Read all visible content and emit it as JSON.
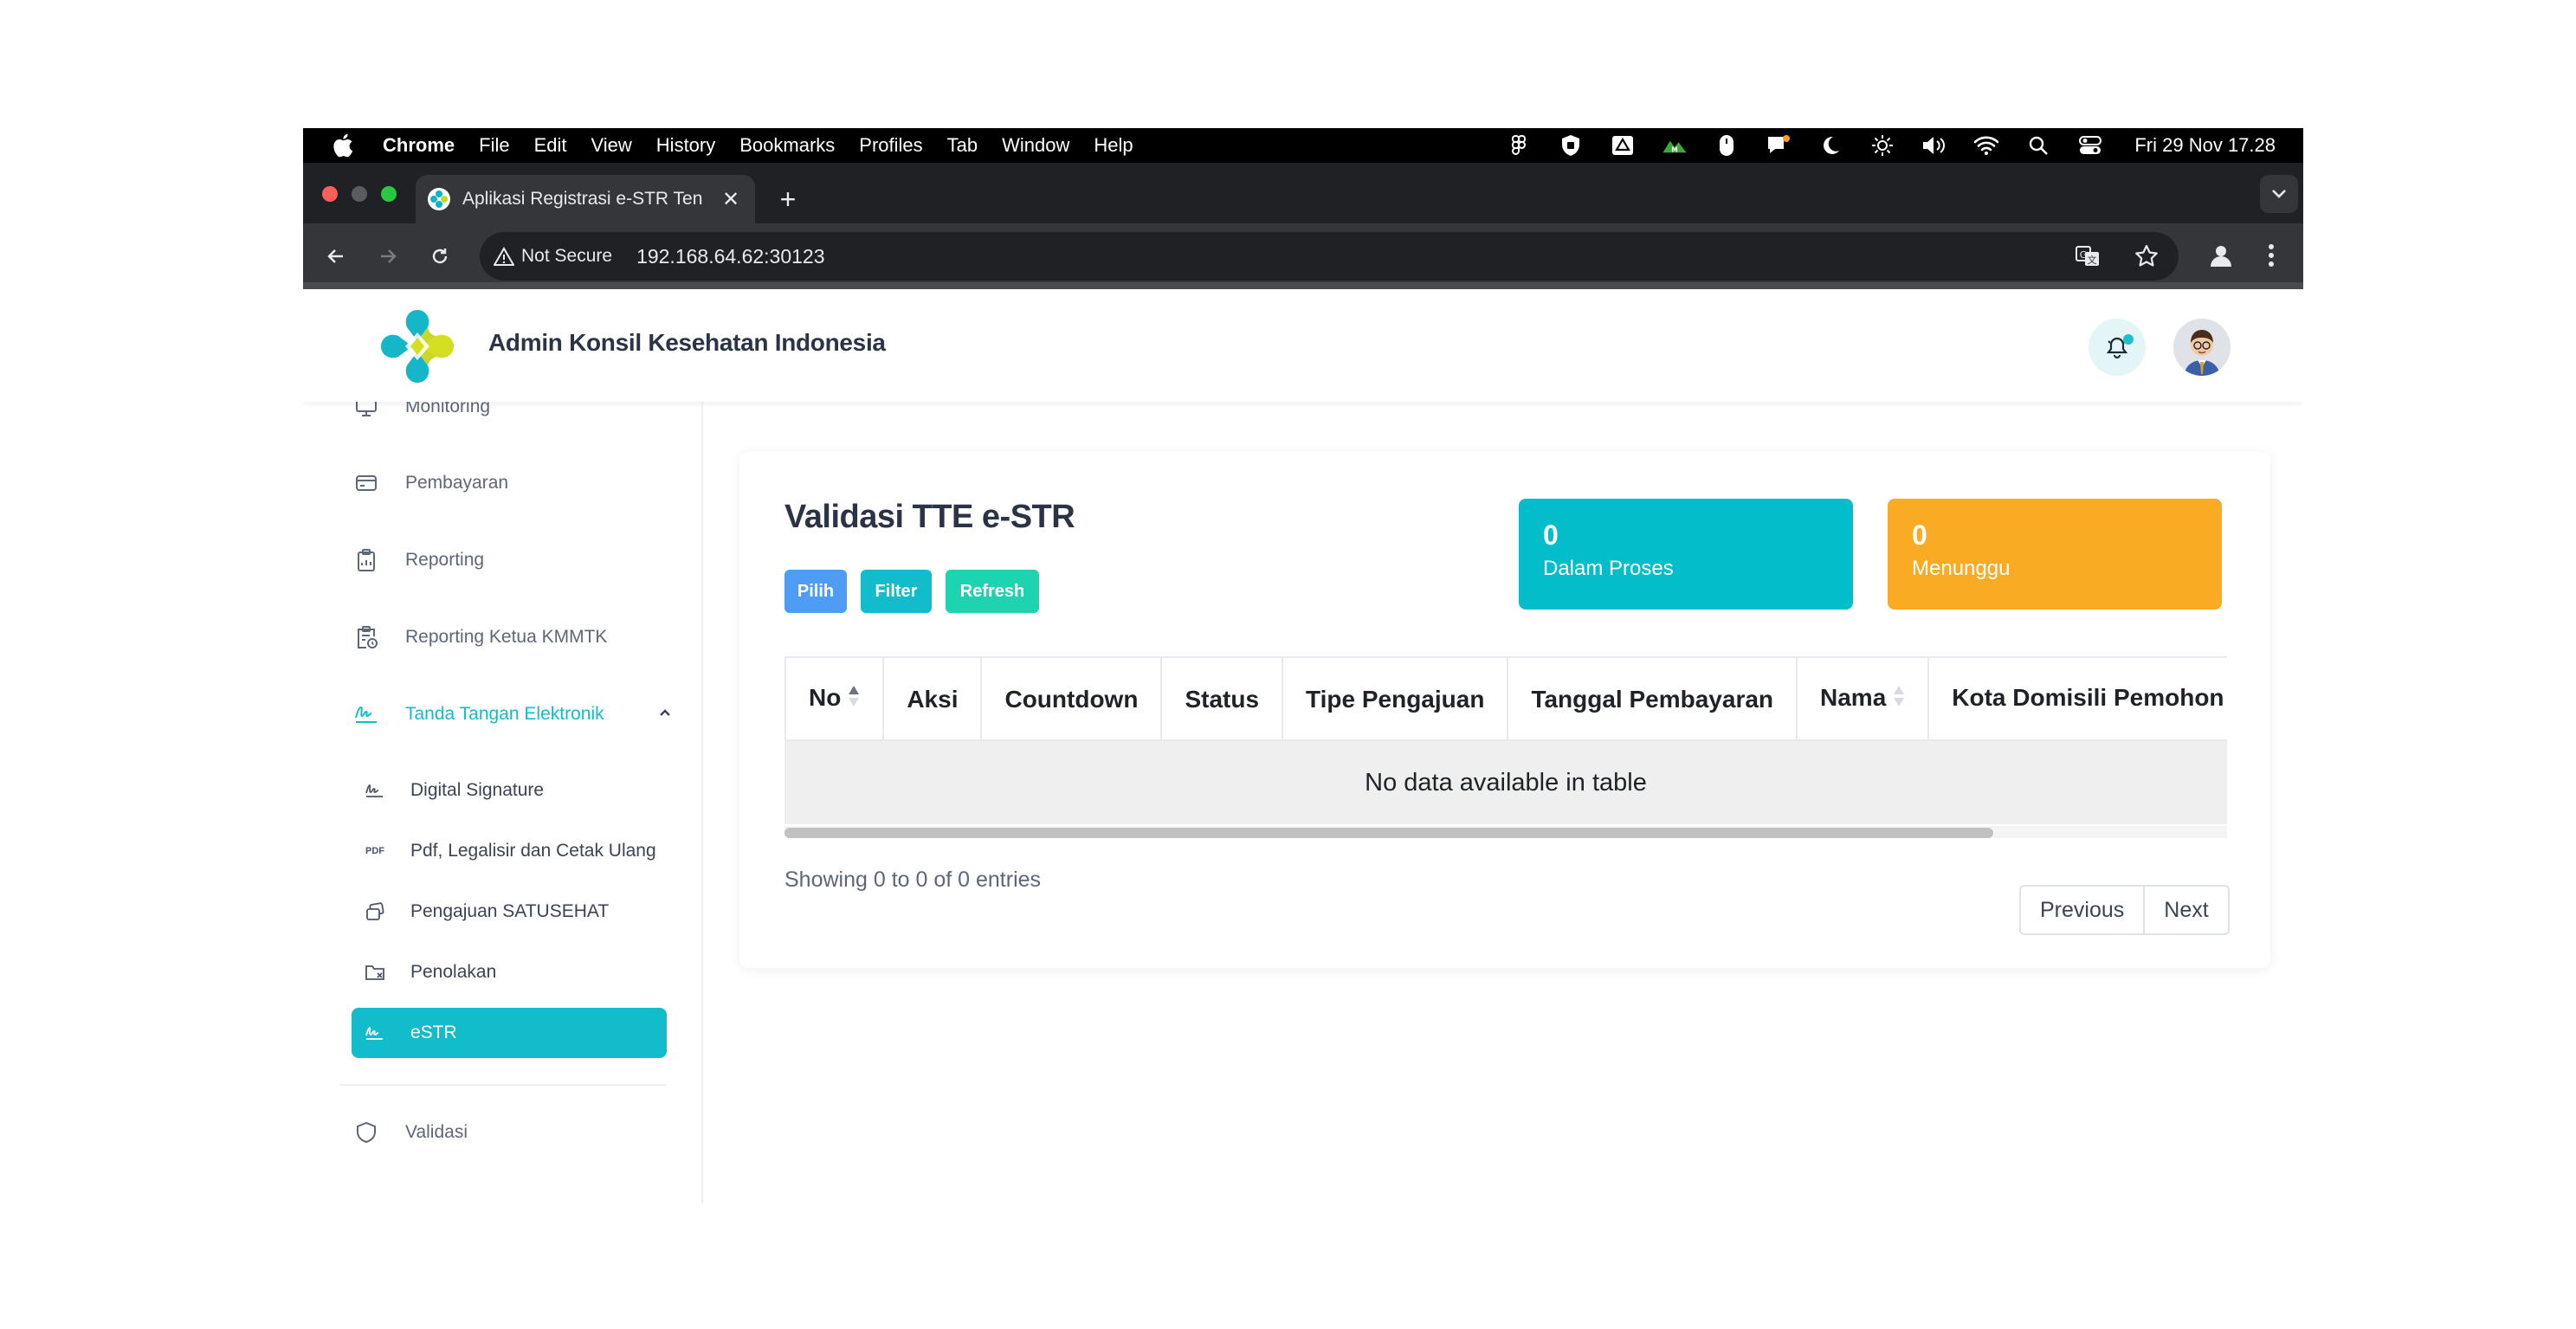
{
  "menubar": {
    "app": "Chrome",
    "items": [
      "File",
      "Edit",
      "View",
      "History",
      "Bookmarks",
      "Profiles",
      "Tab",
      "Window",
      "Help"
    ],
    "clock": "Fri 29 Nov  17.28"
  },
  "browser": {
    "tab_title": "Aplikasi Registrasi e-STR Ten",
    "not_secure": "Not Secure",
    "url": "192.168.64.62:30123"
  },
  "header": {
    "title": "Admin Konsil Kesehatan Indonesia"
  },
  "sidebar": {
    "top_partial": "Monitoring",
    "items": [
      {
        "label": "Pembayaran",
        "icon": "card-icon"
      },
      {
        "label": "Reporting",
        "icon": "clipboard-icon"
      },
      {
        "label": "Reporting Ketua KMMTK",
        "icon": "clipboard-clock-icon"
      },
      {
        "label": "Tanda Tangan Elektronik",
        "icon": "signature-icon"
      }
    ],
    "sub_items": [
      {
        "label": "Digital Signature",
        "icon": "signature-icon"
      },
      {
        "label": "Pdf, Legalisir dan Cetak Ulang",
        "icon": "pdf-icon",
        "icon_text": "PDF"
      },
      {
        "label": "Pengajuan SATUSEHAT",
        "icon": "copy-icon"
      },
      {
        "label": "Penolakan",
        "icon": "folder-x-icon"
      },
      {
        "label": "eSTR",
        "icon": "signature-icon",
        "active": true
      }
    ],
    "bottom": {
      "label": "Validasi",
      "icon": "shield-icon"
    }
  },
  "main": {
    "title": "Validasi TTE e-STR",
    "buttons": {
      "pilih": "Pilih",
      "filter": "Filter",
      "refresh": "Refresh"
    },
    "stats": [
      {
        "value": "0",
        "label": "Dalam Proses",
        "color": "#04bdca"
      },
      {
        "value": "0",
        "label": "Menunggu",
        "color": "#f8ab23"
      }
    ],
    "table": {
      "columns": [
        "No",
        "Aksi",
        "Countdown",
        "Status",
        "Tipe Pengajuan",
        "Tanggal Pembayaran",
        "Nama",
        "Kota Domisili Pemohon"
      ],
      "empty": "No data available in table"
    },
    "info": "Showing 0 to 0 of 0 entries",
    "pager": {
      "previous": "Previous",
      "next": "Next"
    }
  },
  "colors": {
    "accent": "#12bccb",
    "blue_button": "#4e9cf4",
    "filter_button": "#12bccb",
    "refresh_button": "#1ed3b0"
  }
}
